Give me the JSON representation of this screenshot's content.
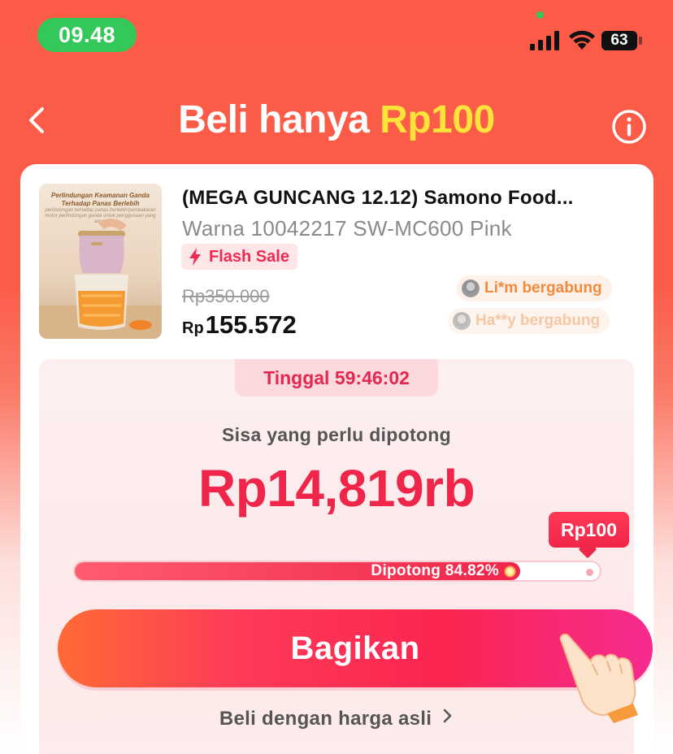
{
  "status_bar": {
    "time": "09.48",
    "battery": "63",
    "colors": {
      "time_pill": "#34c759"
    }
  },
  "header": {
    "title_prefix": "Beli hanya ",
    "title_highlight": "Rp100",
    "back_icon": "chevron-left-icon",
    "info_icon": "info-circle-icon",
    "colors": {
      "highlight": "#ffe23a",
      "background": "#fb5b47"
    }
  },
  "product": {
    "image_caption": "Perlindungan Keamanan Ganda Terhadap Panas Berlebih",
    "image_subcaption": "perlindungan terhadap panas berlebih/pembakaran motor perlindungan ganda untuk penggunaan yang aman",
    "title": "(MEGA GUNCANG 12.12) Samono Food...",
    "variant": "Warna 10042217 SW-MC600 Pink",
    "badge": "Flash Sale",
    "badge_icon": "lightning-icon",
    "original_price": "Rp350.000",
    "price_currency": "Rp",
    "price_amount": "155.572",
    "joined": [
      {
        "text": "Li*m bergabung"
      },
      {
        "text": "Ha**y bergabung"
      }
    ]
  },
  "bargain": {
    "timer": "Tinggal 59:46:02",
    "remaining_label": "Sisa yang perlu dipotong",
    "remaining_amount": "Rp14,819rb",
    "target_tag": "Rp100",
    "progress_label": "Dipotong 84.82%",
    "progress_fraction": 0.8482,
    "share_button": "Bagikan",
    "buy_original": "Beli dengan harga asli",
    "colors": {
      "accent": "#f0254a",
      "panel": "#fdeff0"
    }
  }
}
